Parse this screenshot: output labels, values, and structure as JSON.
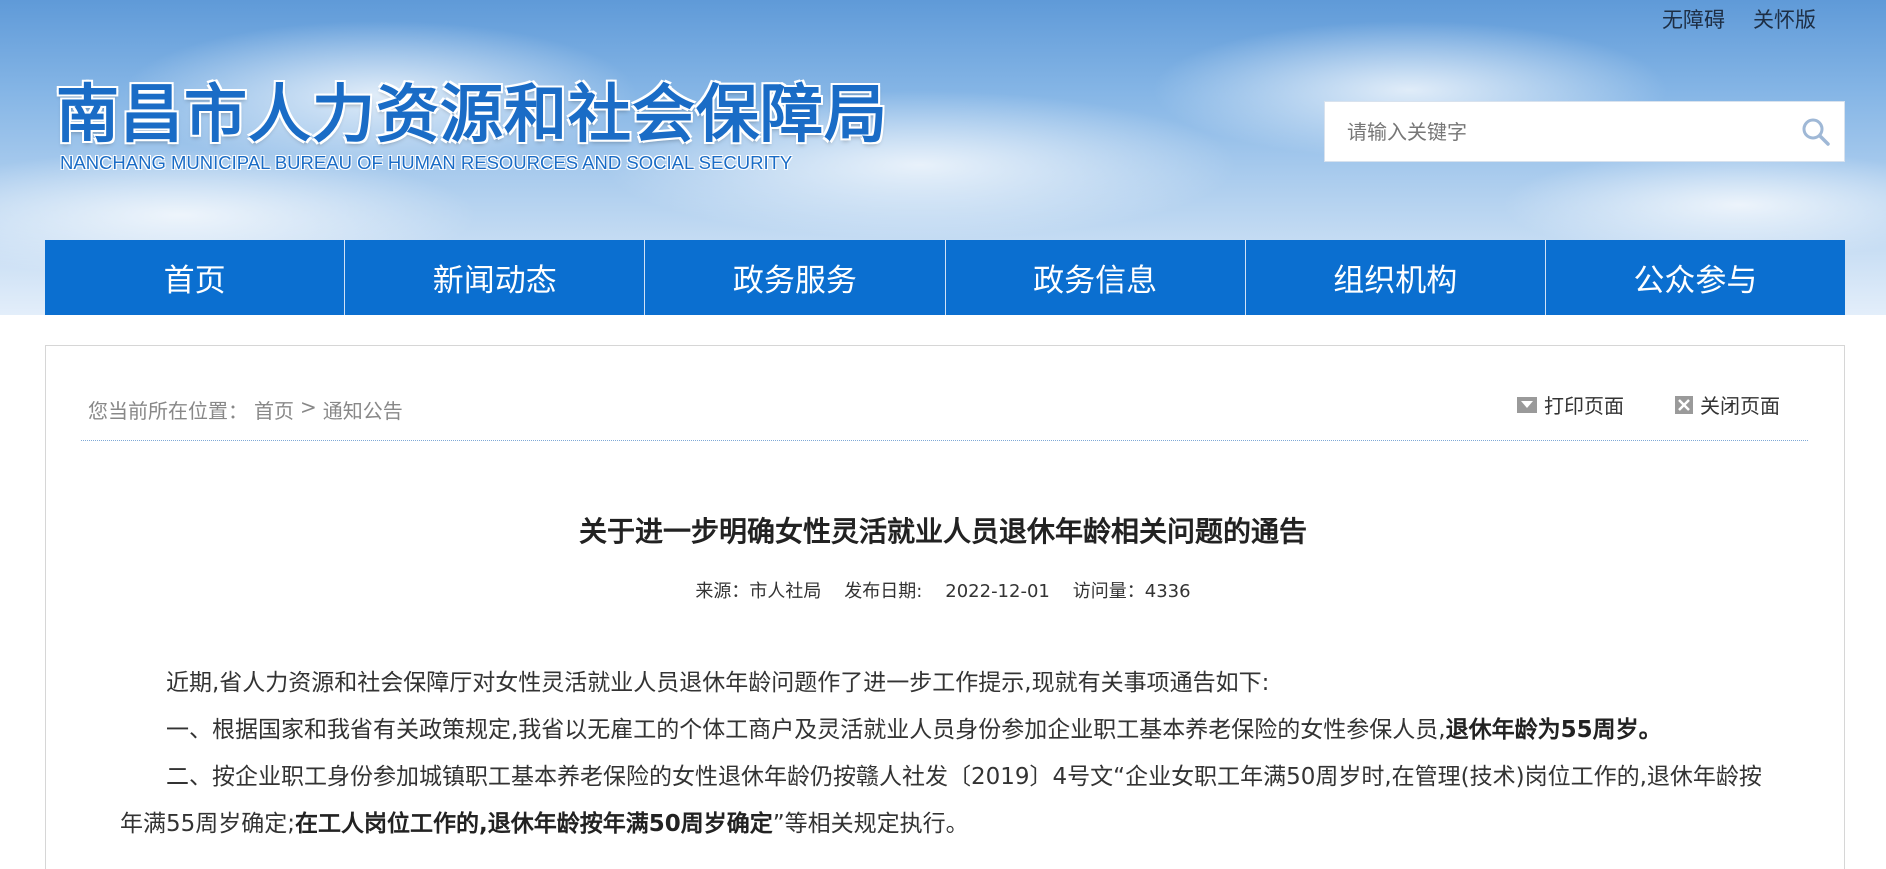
{
  "top_links": {
    "accessibility": "无障碍",
    "care_version": "关怀版"
  },
  "logo": {
    "cn": "南昌市人力资源和社会保障局",
    "en": "NANCHANG MUNICIPAL BUREAU OF HUMAN RESOURCES AND SOCIAL SECURITY"
  },
  "search": {
    "placeholder": "请输入关键字"
  },
  "nav": [
    {
      "label": "首页"
    },
    {
      "label": "新闻动态"
    },
    {
      "label": "政务服务"
    },
    {
      "label": "政务信息"
    },
    {
      "label": "组织机构"
    },
    {
      "label": "公众参与"
    }
  ],
  "breadcrumb": {
    "prefix": "您当前所在位置：",
    "home": "首页",
    "sep": ">",
    "current": "通知公告"
  },
  "tools": {
    "print": "打印页面",
    "close": "关闭页面"
  },
  "article": {
    "title": "关于进一步明确女性灵活就业人员退休年龄相关问题的通告",
    "meta": "来源：市人社局    发布日期:    2022-12-01    访问量：4336",
    "p1": "近期,省人力资源和社会保障厅对女性灵活就业人员退休年龄问题作了进一步工作提示,现就有关事项通告如下:",
    "p2_a": "一、根据国家和我省有关政策规定,我省以无雇工的个体工商户及灵活就业人员身份参加企业职工基本养老保险的女性参保人员,",
    "p2_b": "退休年龄为55周岁。",
    "p3_a": "二、按企业职工身份参加城镇职工基本养老保险的女性退休年龄仍按赣人社发〔2019〕4号文“企业女职工年满50周岁时,在管理(技术)岗位工作的,退休年龄按年满55周岁确定;",
    "p3_b": "在工人岗位工作的,退休年龄按年满50周岁确定",
    "p3_c": "”等相关规定执行。"
  },
  "colors": {
    "nav_bg": "#0b6fd0",
    "logo": "#1a6cc6",
    "divider": "#7fa9d6"
  },
  "icons": {
    "search": "search-icon",
    "print": "print-icon",
    "close": "close-icon"
  }
}
